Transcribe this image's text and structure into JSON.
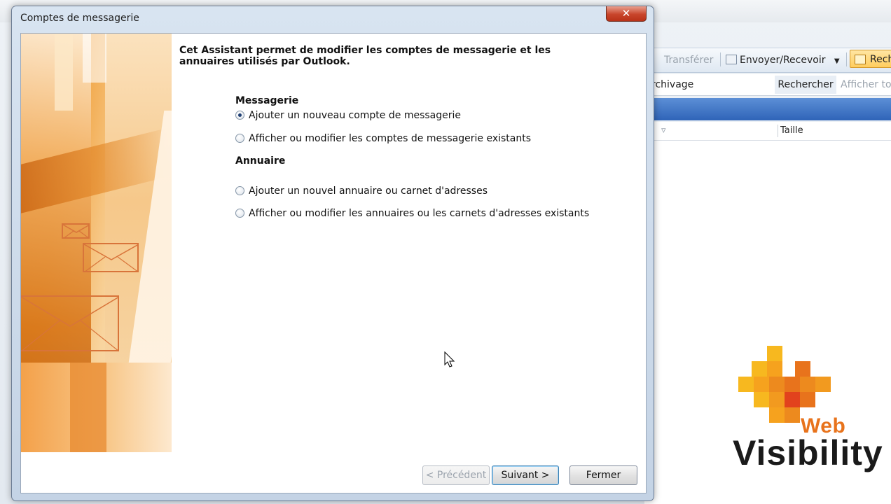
{
  "background_window": {
    "toolbar": {
      "transferer_label": "Transférer",
      "envoyer_recevoir_label": "Envoyer/Recevoir",
      "rechercher_partial_label": "Rech"
    },
    "search": {
      "field_text": "rchivage",
      "rechercher_label": "Rechercher",
      "afficher_partial_label": "Afficher to"
    },
    "column_header": {
      "taille_label": "Taille"
    }
  },
  "dialog": {
    "title": "Comptes de messagerie",
    "close_label": "✕",
    "intro_text": "Cet Assistant permet de modifier les comptes de messagerie et les annuaires utilisés par Outlook.",
    "messagerie": {
      "title": "Messagerie",
      "option_add": "Ajouter un nouveau compte de messagerie",
      "option_view": "Afficher ou modifier les comptes de messagerie existants"
    },
    "annuaire": {
      "title": "Annuaire",
      "option_add": "Ajouter un nouvel annuaire ou carnet d'adresses",
      "option_view": "Afficher ou modifier les annuaires ou les carnets d'adresses existants"
    },
    "buttons": {
      "previous": "< Précédent",
      "next": "Suivant >",
      "close": "Fermer"
    }
  },
  "watermark": {
    "web": "Web",
    "visibility": "Visibility"
  },
  "colors": {
    "logo_orange": "#e8731c",
    "logo_yellow": "#f7b81f",
    "logo_red": "#e2421d",
    "title_blue": "#2f64b8"
  }
}
